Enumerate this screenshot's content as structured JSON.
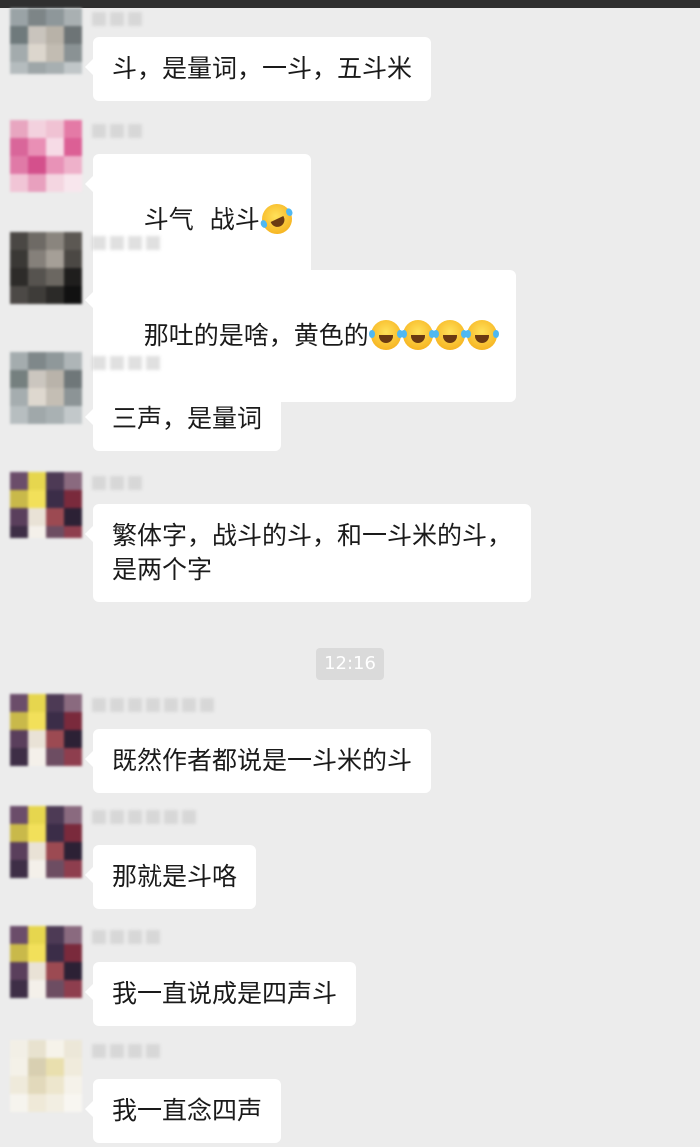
{
  "timestamp": "12:16",
  "messages": [
    {
      "text": "斗，是量词，一斗，五斗米",
      "emoji": []
    },
    {
      "text": "斗气  战斗",
      "emoji": [
        "rolling-on-floor-laughing"
      ]
    },
    {
      "text": "那吐的是啥，黄色的",
      "emoji": [
        "face-with-tears-of-joy",
        "face-with-tears-of-joy",
        "face-with-tears-of-joy",
        "face-with-tears-of-joy"
      ]
    },
    {
      "text": "三声，是量词",
      "emoji": []
    },
    {
      "text": "繁体字，战斗的斗，和一斗米的斗，\n是两个字",
      "emoji": []
    },
    {
      "text": "既然作者都说是一斗米的斗",
      "emoji": []
    },
    {
      "text": "那就是斗咯",
      "emoji": []
    },
    {
      "text": "我一直说成是四声斗",
      "emoji": []
    },
    {
      "text": "我一直念四声",
      "emoji": []
    }
  ],
  "colors": {
    "background": "#ececec",
    "bubble": "#ffffff",
    "text": "#1a1a1a",
    "timestamp_bg": "#dadada",
    "timestamp_text": "#ffffff"
  }
}
